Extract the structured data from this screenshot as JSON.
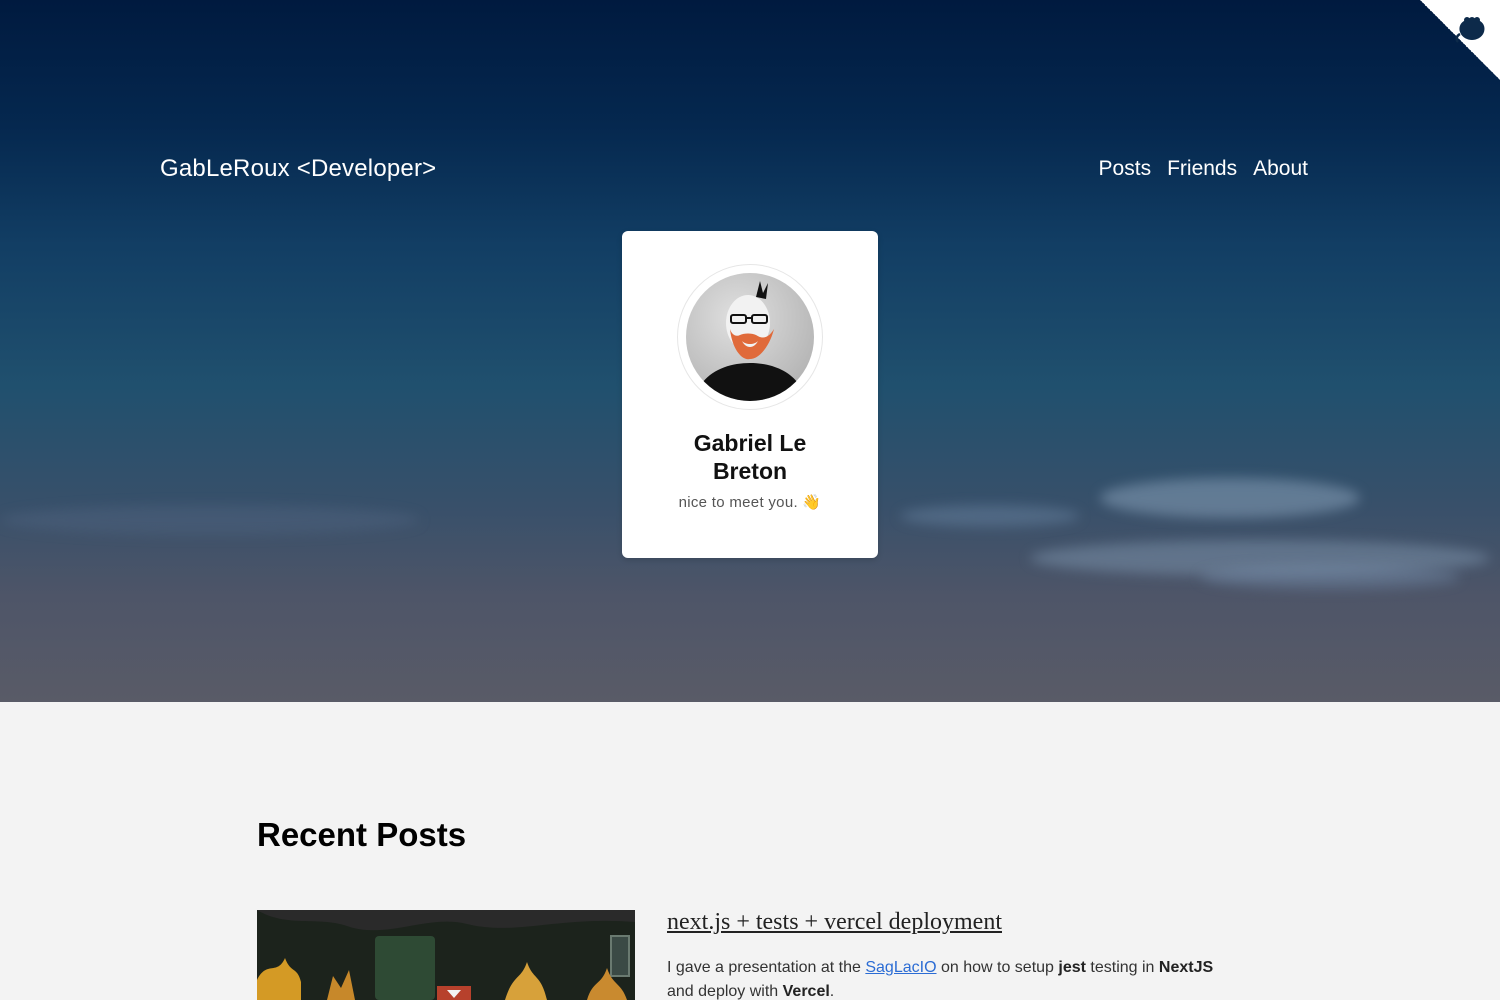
{
  "site": {
    "brand": "GabLeRoux <Developer>",
    "nav": [
      "Posts",
      "Friends",
      "About"
    ]
  },
  "profile": {
    "name": "Gabriel Le Breton",
    "tagline": "nice to meet you. 👋"
  },
  "recent": {
    "heading": "Recent Posts",
    "posts": [
      {
        "title": "next.js + tests + vercel deployment",
        "excerpt": {
          "t1": "I gave a presentation at the ",
          "link": "SagLacIO",
          "t2": " on how to setup ",
          "b1": "jest",
          "t3": " testing in ",
          "b2": "NextJS",
          "t4": " and deploy with ",
          "b3": "Vercel",
          "t5": "."
        }
      }
    ]
  },
  "icons": {
    "corner": "github-octocat-icon"
  },
  "colors": {
    "link": "#2b6cd4",
    "hero_top": "#001a3f",
    "background": "#f3f3f3"
  }
}
